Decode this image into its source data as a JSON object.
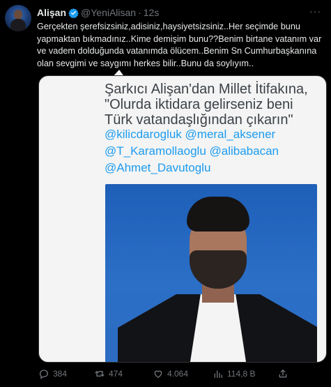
{
  "tweet": {
    "author_name": "Alişan",
    "handle": "@YeniAlisan",
    "separator": "·",
    "time": "12s",
    "more": "···",
    "text": "Gerçekten şerefsizsiniz,adisiniz,haysiyetsizsiniz..Her seçimde bunu yapmaktan bıkmadınız..Kime demişim bunu??Benim birtane vatanım var ve vadem dolduğunda vatanımda ölücem..Benim Sn Cumhurbaşkanına olan sevgimi ve saygımı herkes bilir..Bunu da soylıyım.."
  },
  "media": {
    "headline": "Şarkıcı Alişan'dan Millet İtifakına, \"Olurda iktidara gelirseniz beni Türk vatandaşlığından çıkarın\"",
    "mentions": [
      "@kilicdarogluk @meral_aksener",
      "@T_Karamollaoglu @alibabacan",
      "@Ahmet_Davutoglu"
    ]
  },
  "actions": {
    "replies": "384",
    "retweets": "474",
    "likes": "4.064",
    "views": "114,8 B"
  },
  "colors": {
    "background": "#000000",
    "text": "#e7e9ea",
    "muted": "#71767b",
    "accent": "#1d9bf0"
  },
  "icons": [
    "avatar",
    "verified-badge-icon",
    "more-icon",
    "reply-icon",
    "retweet-icon",
    "like-icon",
    "views-icon",
    "share-icon"
  ]
}
